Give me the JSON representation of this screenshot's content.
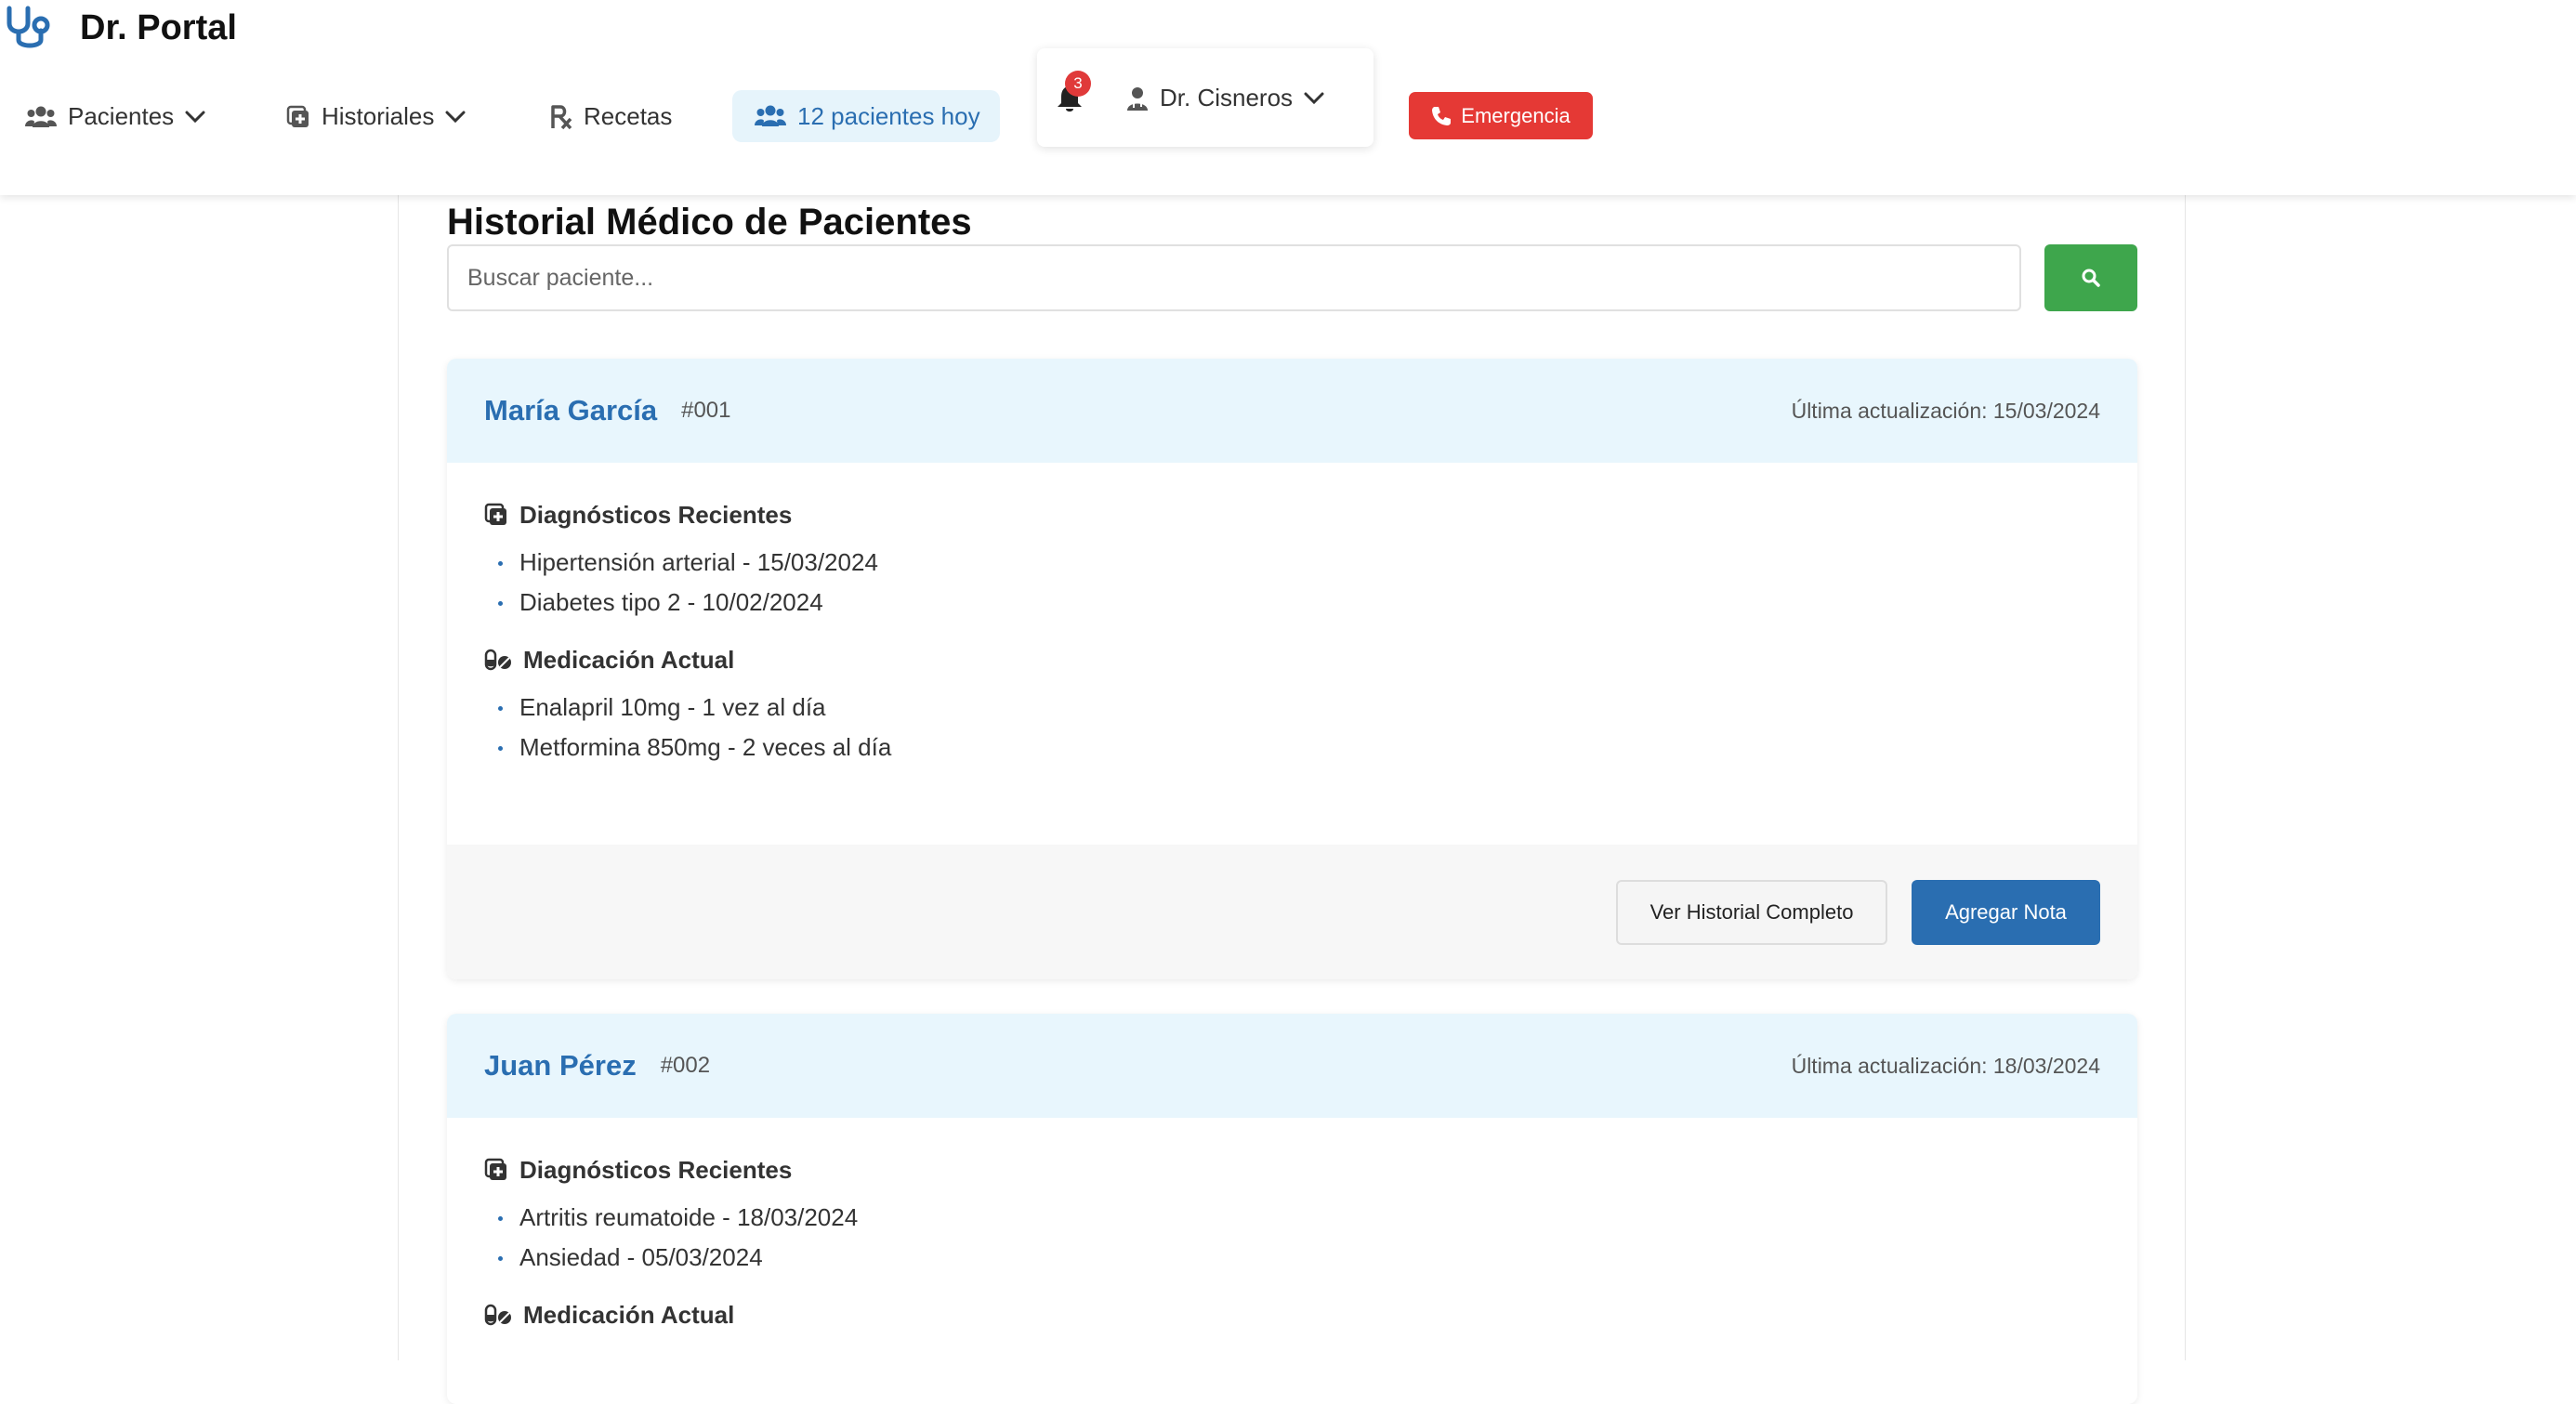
{
  "app": {
    "brand": "Dr. Portal",
    "logo_icon": "stethoscope-icon"
  },
  "nav": {
    "pacientes": "Pacientes",
    "historiales": "Historiales",
    "recetas": "Recetas",
    "today": "12 pacientes hoy",
    "notifications_count": "3",
    "doctor": "Dr. Cisneros",
    "emergency": "Emergencia"
  },
  "page": {
    "title": "Historial Médico de Pacientes",
    "search_placeholder": "Buscar paciente..."
  },
  "patients": [
    {
      "name": "María García",
      "id": "#001",
      "updated": "Última actualización: 15/03/2024",
      "diagnoses_title": "Diagnósticos Recientes",
      "diagnoses": [
        "Hipertensión arterial - 15/03/2024",
        "Diabetes tipo 2 - 10/02/2024"
      ],
      "meds_title": "Medicación Actual",
      "meds": [
        "Enalapril 10mg - 1 vez al día",
        "Metformina 850mg - 2 veces al día"
      ],
      "btn_history": "Ver Historial Completo",
      "btn_note": "Agregar Nota"
    },
    {
      "name": "Juan Pérez",
      "id": "#002",
      "updated": "Última actualización: 18/03/2024",
      "diagnoses_title": "Diagnósticos Recientes",
      "diagnoses": [
        "Artritis reumatoide - 18/03/2024",
        "Ansiedad - 05/03/2024"
      ],
      "meds_title": "Medicación Actual"
    }
  ],
  "colors": {
    "accent": "#2a6eb1",
    "emergency": "#e53935",
    "search_button": "#3ea64c",
    "card_header": "#e8f6fd"
  }
}
